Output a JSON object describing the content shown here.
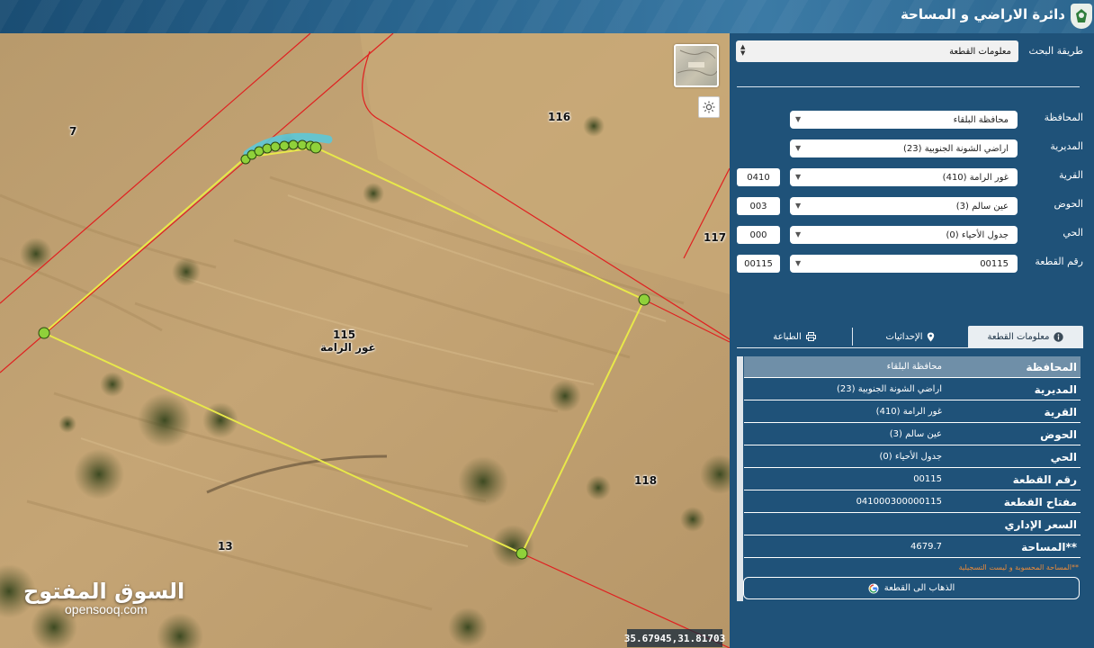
{
  "header": {
    "title": "دائرة الاراضي و المساحة",
    "logo_icon": "dls-logo-icon"
  },
  "map": {
    "parcel_labels": {
      "p7": "7",
      "p116": "116",
      "p117": "117",
      "p115": "115",
      "village": "غور الرامة",
      "p118": "118",
      "p13": "13"
    },
    "coordinates": "35.67945,31.81703",
    "watermark": {
      "arabic": "السوق المفتوح",
      "latin": "opensooq.com"
    }
  },
  "panel": {
    "search_method_label": "طريقة البحث",
    "search_method_value": "معلومات القطعة",
    "fields": {
      "governorate": {
        "label": "المحافظة",
        "value": "محافظة البلقاء",
        "code": ""
      },
      "directorate": {
        "label": "المديرية",
        "value": "اراضي الشونة الجنوبية (23)",
        "code": ""
      },
      "village": {
        "label": "القرية",
        "value": "غور الرامة (410)",
        "code": "0410"
      },
      "basin": {
        "label": "الحوض",
        "value": "عين سالم (3)",
        "code": "003"
      },
      "district": {
        "label": "الحي",
        "value": "جدول الأحياء (0)",
        "code": "000"
      },
      "parcel": {
        "label": "رقم القطعة",
        "value": "00115",
        "code": "00115"
      }
    },
    "tabs": {
      "info": "معلومات القطعة",
      "coords": "الإحداثيات",
      "print": "الطباعة"
    },
    "info": {
      "governorate": {
        "key": "المحافظة",
        "value": "محافظة البلقاء"
      },
      "directorate": {
        "key": "المديرية",
        "value": "اراضي الشونة الجنوبية (23)"
      },
      "village": {
        "key": "القرية",
        "value": "غور الرامة (410)"
      },
      "basin": {
        "key": "الحوض",
        "value": "عين سالم (3)"
      },
      "district": {
        "key": "الحي",
        "value": "جدول الأحياء (0)"
      },
      "parcel_no": {
        "key": "رقم القطعة",
        "value": "00115"
      },
      "parcel_key": {
        "key": "مفتاح القطعة",
        "value": "041000300000115"
      },
      "admin_price": {
        "key": "السعر الإداري",
        "value": ""
      },
      "area": {
        "key": "**المساحة",
        "value": "4679.7"
      }
    },
    "note": "**المساحة المحسوبة و ليست التسجيلية",
    "goto_button": "الذهاب الى القطعة"
  },
  "colors": {
    "panel_bg": "#1f5279",
    "header_bg": "#2a6690",
    "parcel_outline": "#e8e84a",
    "vertex": "#8fd13a",
    "cadastre_line": "#e02020",
    "note_text": "#e88a3a"
  }
}
